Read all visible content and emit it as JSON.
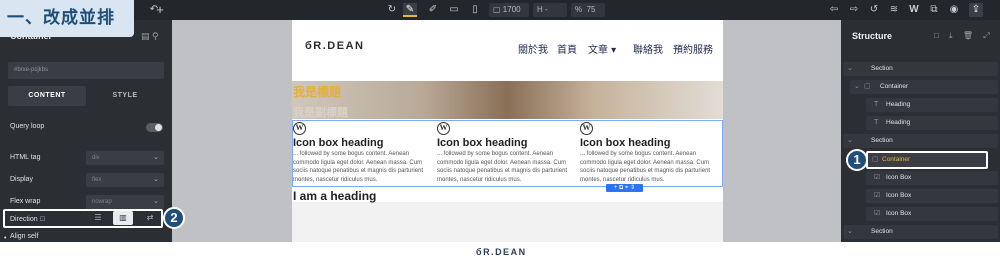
{
  "overlay_title": "一、改成並排",
  "topbar": {
    "left_icons": [
      "undo-icon",
      "add-icon"
    ],
    "tools": [
      "refresh-icon",
      "pen-icon",
      "edit-icon",
      "desktop-icon",
      "mobile-icon",
      "lock-icon"
    ],
    "width_value": "1700",
    "height_value": "-",
    "zoom_value": "75",
    "zoom_unit": "%",
    "width_prefix": "▢",
    "height_prefix": "H",
    "right_icons": [
      "undo-arrow-icon",
      "redo-arrow-icon",
      "history-icon",
      "layers-icon",
      "wordpress-icon",
      "external-link-icon",
      "preview-icon",
      "save-icon"
    ]
  },
  "left_panel": {
    "title": "Container",
    "search_value": "#brxe-pcjkbs",
    "tabs": [
      "CONTENT",
      "STYLE"
    ],
    "query_loop_label": "Query loop",
    "fields": [
      {
        "label": "HTML tag",
        "value": "div"
      },
      {
        "label": "Display",
        "value": "flex"
      },
      {
        "label": "Flex wrap",
        "value": "nowrap"
      }
    ],
    "direction_label": "Direction",
    "align_self_label": "Align self"
  },
  "badges": {
    "one": "1",
    "two": "2"
  },
  "page": {
    "logo_prefix": "б",
    "logo_text": "R.DEAN",
    "nav": [
      "關於我",
      "首頁",
      "文章 ▾",
      "聯絡我",
      "預約服務"
    ],
    "hero_heading": "我是標題",
    "hero_subheading": "我是副標題",
    "icon_boxes": [
      {
        "icon": "W",
        "heading": "Icon box heading",
        "text": "... followed by some bogus content. Aenean commodo ligula eget dolor. Aenean massa. Cum sociis natoque penatibus et magnis dis parturient montes, nascetur ridiculus mus."
      },
      {
        "icon": "W",
        "heading": "Icon box heading",
        "text": "... followed by some bogus content. Aenean commodo ligula eget dolor. Aenean massa. Cum sociis natoque penatibus et magnis dis parturient montes, nascetur ridiculus mus."
      },
      {
        "icon": "W",
        "heading": "Icon box heading",
        "text": "... followed by some bogus content. Aenean commodo ligula eget dolor. Aenean massa. Cum sociis natoque penatibus et magnis dis parturient montes, nascetur ridiculus mus."
      }
    ],
    "mini_toolbar": "+ ⧉ ⌖ ⇕",
    "bottom_heading": "I am a heading"
  },
  "structure": {
    "title": "Structure",
    "icons": "□ ⤓ 🗑 ⤢",
    "items": [
      {
        "label": "Section",
        "glyph": "▢"
      },
      {
        "label": "Container",
        "glyph": "▢"
      },
      {
        "label": "Heading",
        "glyph": "T"
      },
      {
        "label": "Heading",
        "glyph": "T"
      },
      {
        "label": "Section",
        "glyph": "▢"
      },
      {
        "label": "Container",
        "glyph": "▢"
      },
      {
        "label": "Icon Box",
        "glyph": "☑"
      },
      {
        "label": "Icon Box",
        "glyph": "☑"
      },
      {
        "label": "Icon Box",
        "glyph": "☑"
      },
      {
        "label": "Section",
        "glyph": "▢"
      }
    ]
  },
  "footer_logo_prefix": "б",
  "footer_logo_text": "R.DEAN",
  "colors": {
    "accent": "#e8b73a",
    "panel": "#2b2e33",
    "badge": "#1f4e79",
    "selection": "#2f73f5"
  }
}
